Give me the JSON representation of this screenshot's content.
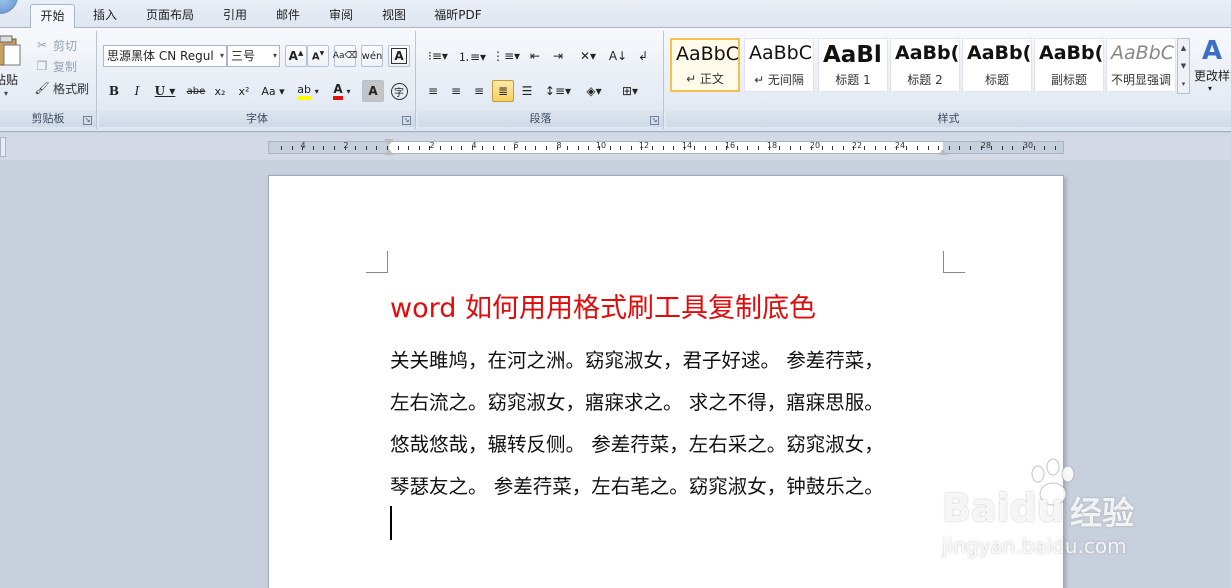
{
  "tabs": [
    "开始",
    "插入",
    "页面布局",
    "引用",
    "邮件",
    "审阅",
    "视图",
    "福昕PDF"
  ],
  "clipboard": {
    "paste_label": "粘贴",
    "cut_label": "剪切",
    "copy_label": "复制",
    "format_painter_label": "格式刷",
    "group_label": "剪贴板"
  },
  "font": {
    "name": "思源黑体 CN Regul",
    "size": "三号",
    "group_label": "字体",
    "highlight_color": "#ffff00",
    "font_color": "#e01010"
  },
  "paragraph": {
    "group_label": "段落"
  },
  "styles": {
    "group_label": "样式",
    "change_styles_label": "更改样式",
    "items": [
      {
        "sample": "AaBbC(",
        "name": "↵ 正文"
      },
      {
        "sample": "AaBbC(",
        "name": "↵ 无间隔"
      },
      {
        "sample": "AaBl",
        "name": "标题 1"
      },
      {
        "sample": "AaBb(",
        "name": "标题 2"
      },
      {
        "sample": "AaBb(",
        "name": "标题"
      },
      {
        "sample": "AaBb(",
        "name": "副标题"
      },
      {
        "sample": "AaBbC(",
        "name": "不明显强调"
      }
    ]
  },
  "ruler": {
    "labels": [
      "4",
      "2",
      "2",
      "4",
      "6",
      "8",
      "10",
      "12",
      "14",
      "16",
      "18",
      "20",
      "22",
      "24",
      "28",
      "30"
    ]
  },
  "document": {
    "title": "word 如何用用格式刷工具复制底色",
    "lines": [
      "关关雎鸠，在河之洲。窈窕淑女，君子好逑。 参差荇菜，",
      "左右流之。窈窕淑女，寤寐求之。 求之不得，寤寐思服。",
      "悠哉悠哉，辗转反侧。 参差荇菜，左右采之。窈窕淑女，",
      "琴瑟友之。 参差荇菜，左右芼之。窈窕淑女，钟鼓乐之。"
    ]
  },
  "watermark": {
    "brand": "Bai",
    "brand_tail": "du",
    "product": "经验",
    "url": "jingyan.baidu.com"
  }
}
